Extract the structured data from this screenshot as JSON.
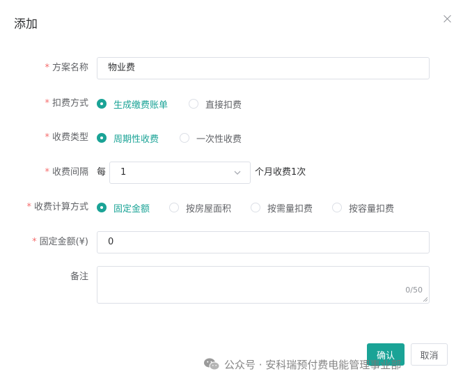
{
  "dialog": {
    "title": "添加"
  },
  "form": {
    "plan_name": {
      "label": "方案名称",
      "value": "物业费"
    },
    "deduction_method": {
      "label": "扣费方式",
      "options": [
        {
          "label": "生成缴费账单",
          "checked": true
        },
        {
          "label": "直接扣费",
          "checked": false
        }
      ]
    },
    "charge_type": {
      "label": "收费类型",
      "options": [
        {
          "label": "周期性收费",
          "checked": true
        },
        {
          "label": "一次性收费",
          "checked": false
        }
      ]
    },
    "charge_interval": {
      "label": "收费间隔",
      "prefix": "每",
      "value": "1",
      "suffix": "个月收费1次"
    },
    "calc_method": {
      "label": "收费计算方式",
      "options": [
        {
          "label": "固定金额",
          "checked": true
        },
        {
          "label": "按房屋面积",
          "checked": false
        },
        {
          "label": "按需量扣费",
          "checked": false
        },
        {
          "label": "按容量扣费",
          "checked": false
        }
      ]
    },
    "fixed_amount": {
      "label": "固定金额(¥)",
      "value": "0"
    },
    "remark": {
      "label": "备注",
      "counter": "0/50"
    }
  },
  "footer": {
    "confirm_label": "确认",
    "cancel_label": "取消"
  },
  "watermark": {
    "text": "公众号 · 安科瑞预付费电能管理事业部"
  },
  "colors": {
    "accent": "#1aa396",
    "required": "#f56c6c",
    "border": "#dcdfe6"
  }
}
